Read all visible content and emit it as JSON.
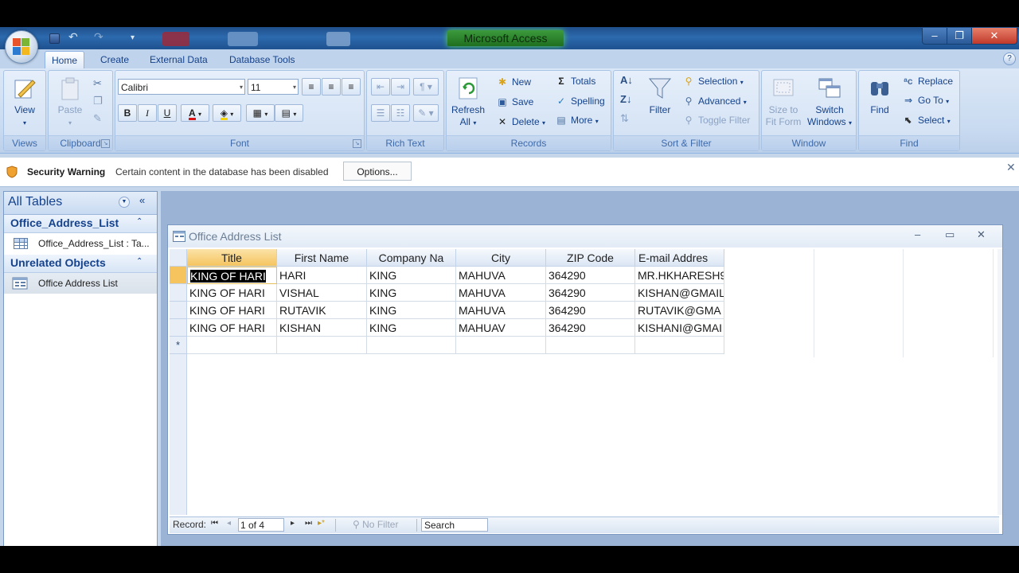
{
  "app": {
    "title": "Microsoft Access"
  },
  "ribbon": {
    "tabs": [
      "Home",
      "Create",
      "External Data",
      "Database Tools"
    ],
    "views": {
      "view_label": "View",
      "group": "Views"
    },
    "clipboard": {
      "paste_label": "Paste",
      "group": "Clipboard"
    },
    "font": {
      "family": "Calibri",
      "size": "11",
      "bold": "B",
      "italic": "I",
      "underline": "U",
      "group": "Font"
    },
    "richtext": {
      "group": "Rich Text"
    },
    "records": {
      "refresh_line1": "Refresh",
      "refresh_line2": "All",
      "new": "New",
      "save": "Save",
      "delete": "Delete",
      "totals": "Totals",
      "spelling": "Spelling",
      "more": "More",
      "group": "Records"
    },
    "sortfilter": {
      "filter": "Filter",
      "selection": "Selection",
      "advanced": "Advanced",
      "toggle": "Toggle Filter",
      "group": "Sort & Filter"
    },
    "window": {
      "size_line1": "Size to",
      "size_line2": "Fit Form",
      "switch_line1": "Switch",
      "switch_line2": "Windows",
      "group": "Window"
    },
    "find": {
      "find": "Find",
      "replace": "Replace",
      "goto": "Go To",
      "select": "Select",
      "group": "Find"
    }
  },
  "security": {
    "label": "Security Warning",
    "message": "Certain content in the database has been disabled",
    "options": "Options..."
  },
  "nav": {
    "title": "All Tables",
    "groups": [
      {
        "title": "Office_Address_List",
        "items": [
          "Office_Address_List : Ta..."
        ]
      },
      {
        "title": "Unrelated Objects",
        "items": [
          "Office Address List"
        ]
      }
    ]
  },
  "document": {
    "title": "Office Address List",
    "columns": [
      "Title",
      "First Name",
      "Company Na",
      "City",
      "ZIP Code",
      "E-mail Addres"
    ],
    "rows": [
      [
        "KING OF HARI",
        "HARI",
        "KING",
        "MAHUVA",
        "364290",
        "MR.HKHARESH9"
      ],
      [
        "KING OF HARI",
        "VISHAL",
        "KING",
        "MAHUVA",
        "364290",
        "KISHAN@GMAIL"
      ],
      [
        "KING OF HARI",
        "RUTAVIK",
        "KING",
        "MAHUVA",
        "364290",
        "RUTAVIK@GMA"
      ],
      [
        "KING OF HARI",
        "KISHAN",
        "KING",
        "MAHUAV",
        "364290",
        "KISHANI@GMAI"
      ]
    ],
    "new_row_marker": "*",
    "recnav": {
      "label": "Record:",
      "position": "1 of 4",
      "filter": "No Filter",
      "search": "Search"
    }
  },
  "icons": {
    "window_minimize": "–",
    "window_maximize": "❐",
    "window_close": "✕",
    "doc_minimize": "–",
    "doc_maximize": "▭",
    "doc_close": "✕",
    "nav_collapse": "«",
    "group_collapse": "⌃",
    "first": "⏮",
    "prev": "◂",
    "next": "▸",
    "last": "⏭",
    "new_record": "▸*"
  },
  "colors": {
    "accent": "#15428b",
    "ribbon": "#d5e3f5",
    "active_header": "#f5c45f"
  }
}
